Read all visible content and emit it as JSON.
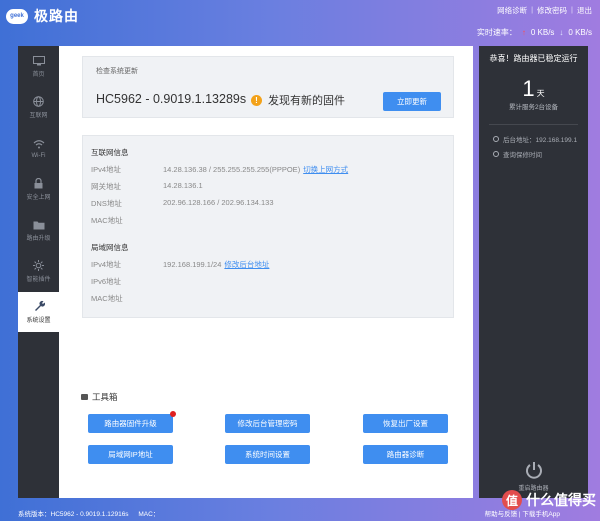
{
  "header": {
    "logo_badge": "geek",
    "app_title": "极路由",
    "links": [
      "网络诊断",
      "修改密码",
      "退出"
    ],
    "rate_label": "实时速率：",
    "upload": "0 KB/s",
    "download": "0 KB/s"
  },
  "sidebar": {
    "items": [
      {
        "label": "首页",
        "icon": "monitor-icon"
      },
      {
        "label": "互联网",
        "icon": "globe-icon"
      },
      {
        "label": "Wi-Fi",
        "icon": "wifi-icon"
      },
      {
        "label": "安全上网",
        "icon": "lock-icon"
      },
      {
        "label": "路由升级",
        "icon": "folder-icon"
      },
      {
        "label": "智能插件",
        "icon": "gear-sun-icon"
      },
      {
        "label": "系统设置",
        "icon": "wrench-icon",
        "active": true
      }
    ]
  },
  "update": {
    "title": "检查系统更新",
    "version": "HC5962 - 0.9019.1.13289s",
    "message": "发现有新的固件",
    "button": "立即更新"
  },
  "internet": {
    "title": "互联网信息",
    "rows": [
      {
        "label": "IPv4地址",
        "value": "14.28.136.38 / 255.255.255.255(PPPOE)",
        "link": "切换上网方式"
      },
      {
        "label": "网关地址",
        "value": "14.28.136.1",
        "link": ""
      },
      {
        "label": "DNS地址",
        "value": "202.96.128.166 / 202.96.134.133",
        "link": ""
      },
      {
        "label": "MAC地址",
        "value": "",
        "link": ""
      }
    ]
  },
  "lan": {
    "title": "局域网信息",
    "rows": [
      {
        "label": "IPv4地址",
        "value": "192.168.199.1/24",
        "link": "修改后台地址"
      },
      {
        "label": "IPv6地址",
        "value": "",
        "link": ""
      },
      {
        "label": "MAC地址",
        "value": "",
        "link": ""
      }
    ]
  },
  "tools": {
    "title": "工具箱",
    "buttons": [
      "路由器固件升级",
      "修改后台管理密码",
      "恢复出厂设置",
      "局域网IP地址",
      "系统时间设置",
      "路由器诊断"
    ]
  },
  "status": {
    "headline": "恭喜！路由器已稳定运行",
    "days": "1",
    "days_unit": "天",
    "served": "累计服务2台设备",
    "admin_addr": "后台地址：192.168.199.1",
    "warranty": "查询保修时间",
    "restart": "重启路由器"
  },
  "footer": {
    "system_version": "系统版本：HC5962 - 0.9019.1.12916s",
    "mac": "MAC：",
    "right_links": "帮助与反馈  |  下载手机App"
  },
  "watermark": {
    "badge": "值",
    "text": "什么值得买"
  },
  "colors": {
    "accent": "#3f8ef0",
    "sidebar_bg": "#2e3138",
    "alert": "#f3a21a",
    "red_dot": "#e02020"
  }
}
